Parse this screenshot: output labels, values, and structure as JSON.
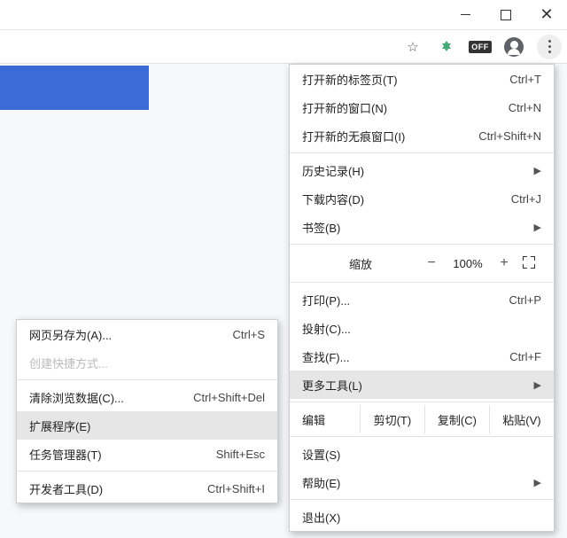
{
  "window_controls": {
    "minimize": "—",
    "maximize": "☐",
    "close": "✕"
  },
  "toolbar": {
    "star_icon": "☆",
    "ext_icon": "ext",
    "off_badge": "OFF",
    "avatar": "avatar",
    "menu_icon": "⋮"
  },
  "main_menu": {
    "new_tab": {
      "label": "打开新的标签页(T)",
      "shortcut": "Ctrl+T"
    },
    "new_window": {
      "label": "打开新的窗口(N)",
      "shortcut": "Ctrl+N"
    },
    "incognito": {
      "label": "打开新的无痕窗口(I)",
      "shortcut": "Ctrl+Shift+N"
    },
    "history": {
      "label": "历史记录(H)"
    },
    "downloads": {
      "label": "下载内容(D)",
      "shortcut": "Ctrl+J"
    },
    "bookmarks": {
      "label": "书签(B)"
    },
    "zoom": {
      "label": "缩放",
      "minus": "−",
      "value": "100%",
      "plus": "+"
    },
    "print": {
      "label": "打印(P)...",
      "shortcut": "Ctrl+P"
    },
    "cast": {
      "label": "投射(C)..."
    },
    "find": {
      "label": "查找(F)...",
      "shortcut": "Ctrl+F"
    },
    "more_tools": {
      "label": "更多工具(L)"
    },
    "edit": {
      "label": "编辑",
      "cut": "剪切(T)",
      "copy": "复制(C)",
      "paste": "粘贴(V)"
    },
    "settings": {
      "label": "设置(S)"
    },
    "help": {
      "label": "帮助(E)"
    },
    "exit": {
      "label": "退出(X)"
    }
  },
  "sub_menu": {
    "save_as": {
      "label": "网页另存为(A)...",
      "shortcut": "Ctrl+S"
    },
    "create_shortcut": {
      "label": "创建快捷方式..."
    },
    "clear_data": {
      "label": "清除浏览数据(C)...",
      "shortcut": "Ctrl+Shift+Del"
    },
    "extensions": {
      "label": "扩展程序(E)"
    },
    "task_manager": {
      "label": "任务管理器(T)",
      "shortcut": "Shift+Esc"
    },
    "dev_tools": {
      "label": "开发者工具(D)",
      "shortcut": "Ctrl+Shift+I"
    }
  },
  "arrow": "▶"
}
